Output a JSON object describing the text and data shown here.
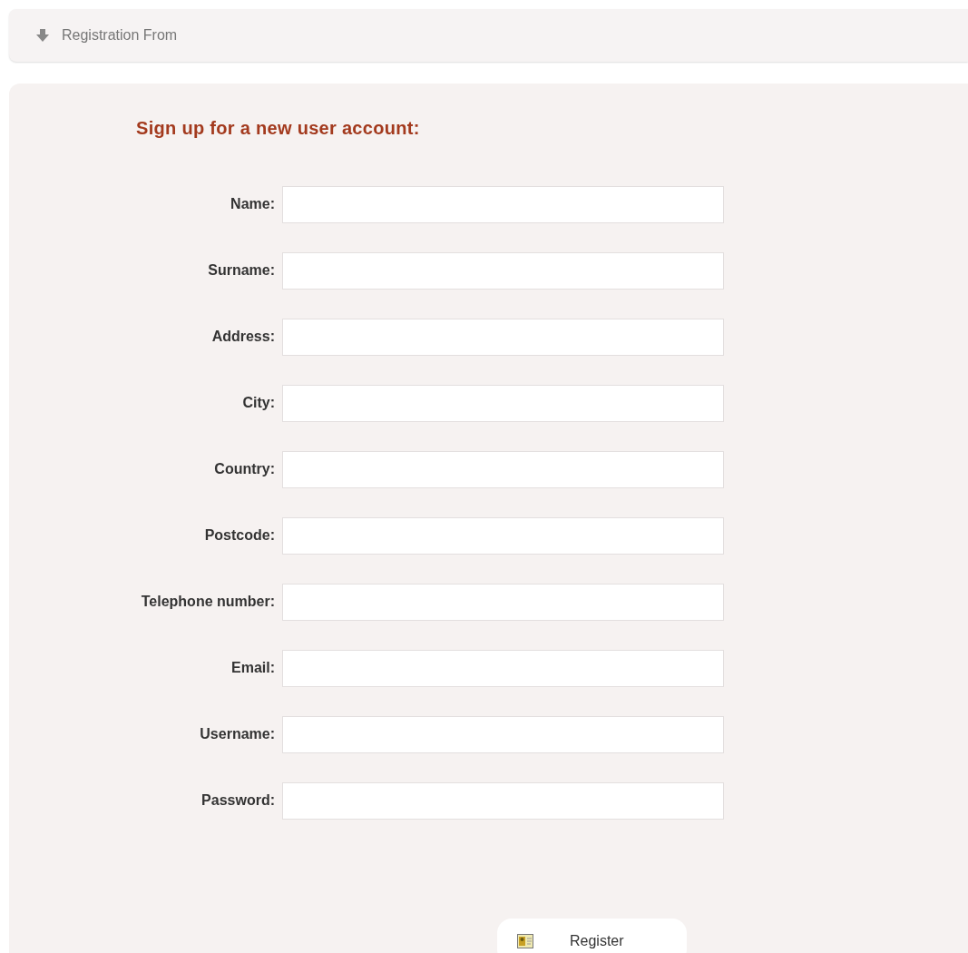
{
  "header": {
    "title": "Registration From"
  },
  "form": {
    "heading": "Sign up for a new user account:",
    "fields": [
      {
        "label": "Name:"
      },
      {
        "label": "Surname:"
      },
      {
        "label": "Address:"
      },
      {
        "label": "City:"
      },
      {
        "label": "Country:"
      },
      {
        "label": "Postcode:"
      },
      {
        "label": "Telephone number:"
      },
      {
        "label": "Email:"
      },
      {
        "label": "Username:"
      },
      {
        "label": "Password:"
      }
    ],
    "submit": {
      "label": "Register"
    }
  }
}
